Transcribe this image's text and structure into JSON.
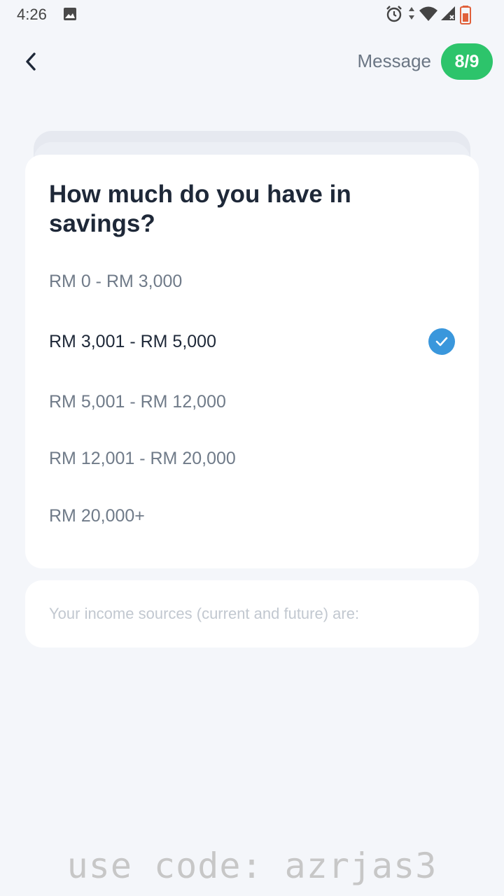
{
  "status_bar": {
    "time": "4:26",
    "icons": [
      "image-icon",
      "alarm-icon",
      "data-arrows-icon",
      "wifi-icon",
      "signal-icon",
      "battery-icon"
    ]
  },
  "header": {
    "back_icon": "chevron-left-icon",
    "message_label": "Message",
    "step": "8/9",
    "badge_color": "#2dc46b"
  },
  "question": {
    "title": "How much do you have in savings?",
    "options": [
      {
        "label": "RM 0 - RM 3,000",
        "selected": false
      },
      {
        "label": "RM 3,001 - RM 5,000",
        "selected": true
      },
      {
        "label": "RM 5,001 - RM 12,000",
        "selected": false
      },
      {
        "label": "RM 12,001 - RM 20,000",
        "selected": false
      },
      {
        "label": "RM 20,000+",
        "selected": false
      }
    ],
    "check_color": "#3a97dc"
  },
  "next_question": {
    "text": "Your income sources (current and future) are:"
  },
  "watermark": {
    "text": "use code: azrjas3"
  }
}
